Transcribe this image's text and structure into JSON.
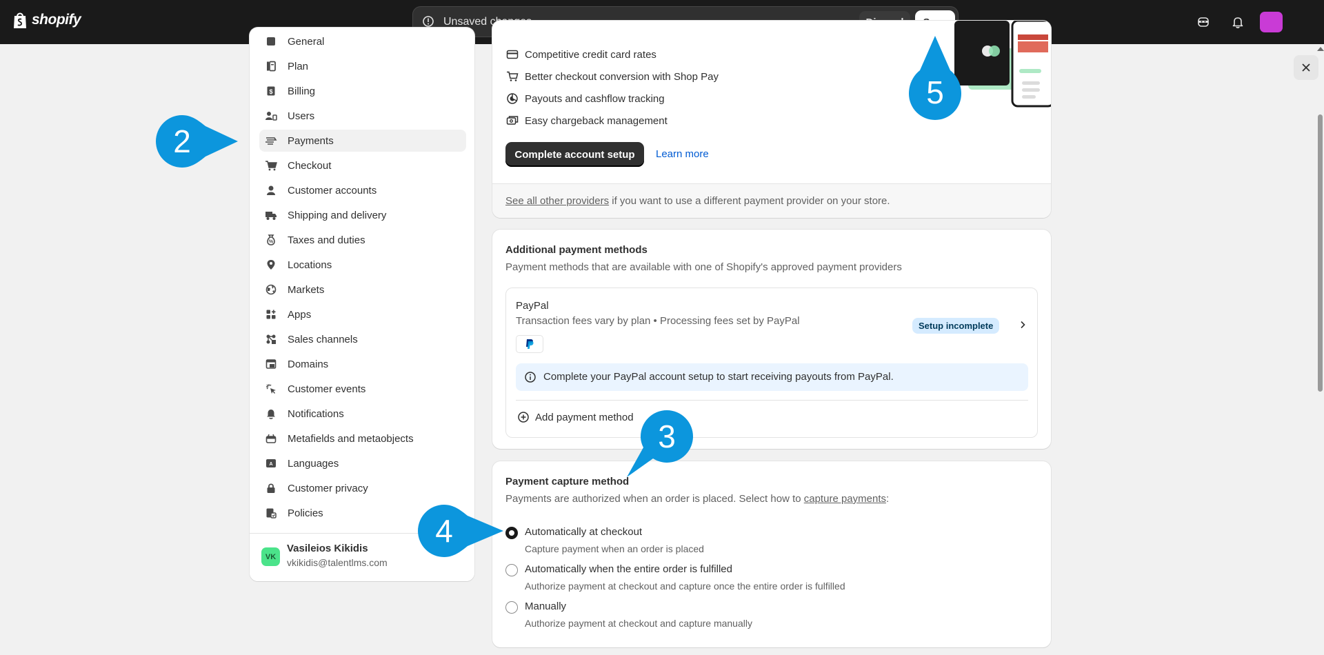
{
  "topbar": {
    "brand": "shopify",
    "unsaved_text": "Unsaved changes",
    "discard_label": "Discard",
    "save_label": "Save"
  },
  "sidebar": {
    "items": [
      {
        "label": "General",
        "icon": "store-icon"
      },
      {
        "label": "Plan",
        "icon": "plan-icon"
      },
      {
        "label": "Billing",
        "icon": "billing-icon"
      },
      {
        "label": "Users",
        "icon": "users-icon"
      },
      {
        "label": "Payments",
        "icon": "payments-icon",
        "active": true
      },
      {
        "label": "Checkout",
        "icon": "cart-icon"
      },
      {
        "label": "Customer accounts",
        "icon": "person-icon"
      },
      {
        "label": "Shipping and delivery",
        "icon": "truck-icon"
      },
      {
        "label": "Taxes and duties",
        "icon": "tax-icon"
      },
      {
        "label": "Locations",
        "icon": "location-icon"
      },
      {
        "label": "Markets",
        "icon": "globe-icon"
      },
      {
        "label": "Apps",
        "icon": "apps-icon"
      },
      {
        "label": "Sales channels",
        "icon": "channels-icon"
      },
      {
        "label": "Domains",
        "icon": "domains-icon"
      },
      {
        "label": "Customer events",
        "icon": "cursor-icon"
      },
      {
        "label": "Notifications",
        "icon": "bell-icon"
      },
      {
        "label": "Metafields and metaobjects",
        "icon": "metafields-icon"
      },
      {
        "label": "Languages",
        "icon": "languages-icon"
      },
      {
        "label": "Customer privacy",
        "icon": "lock-icon"
      },
      {
        "label": "Policies",
        "icon": "policies-icon"
      }
    ],
    "user": {
      "initials": "VK",
      "name": "Vasileios Kikidis",
      "email": "vkikidis@talentlms.com"
    }
  },
  "shop_payments": {
    "features": [
      "Competitive credit card rates",
      "Better checkout conversion with Shop Pay",
      "Payouts and cashflow tracking",
      "Easy chargeback management"
    ],
    "complete_button": "Complete account setup",
    "learn_more": "Learn more",
    "footer_link": "See all other providers",
    "footer_text": " if you want to use a different payment provider on your store."
  },
  "additional": {
    "title": "Additional payment methods",
    "subtitle": "Payment methods that are available with one of Shopify's approved payment providers",
    "paypal": {
      "name": "PayPal",
      "fees": "Transaction fees vary by plan • Processing fees set by PayPal",
      "badge": "Setup incomplete",
      "banner": "Complete your PayPal account setup to start receiving payouts from PayPal."
    },
    "add_method": "Add payment method"
  },
  "capture": {
    "title": "Payment capture method",
    "subtitle_pre": "Payments are authorized when an order is placed. Select how to ",
    "subtitle_link": "capture payments",
    "subtitle_post": ":",
    "options": [
      {
        "label": "Automatically at checkout",
        "help": "Capture payment when an order is placed",
        "checked": true
      },
      {
        "label": "Automatically when the entire order is fulfilled",
        "help": "Authorize payment at checkout and capture once the entire order is fulfilled",
        "checked": false
      },
      {
        "label": "Manually",
        "help": "Authorize payment at checkout and capture manually",
        "checked": false
      }
    ]
  },
  "markers": {
    "m2": "2",
    "m3": "3",
    "m4": "4",
    "m5": "5"
  },
  "colors": {
    "marker": "#0c96dd",
    "topbar": "#1a1a1a",
    "badge_bg": "#d5ebff",
    "link": "#005bd3"
  }
}
